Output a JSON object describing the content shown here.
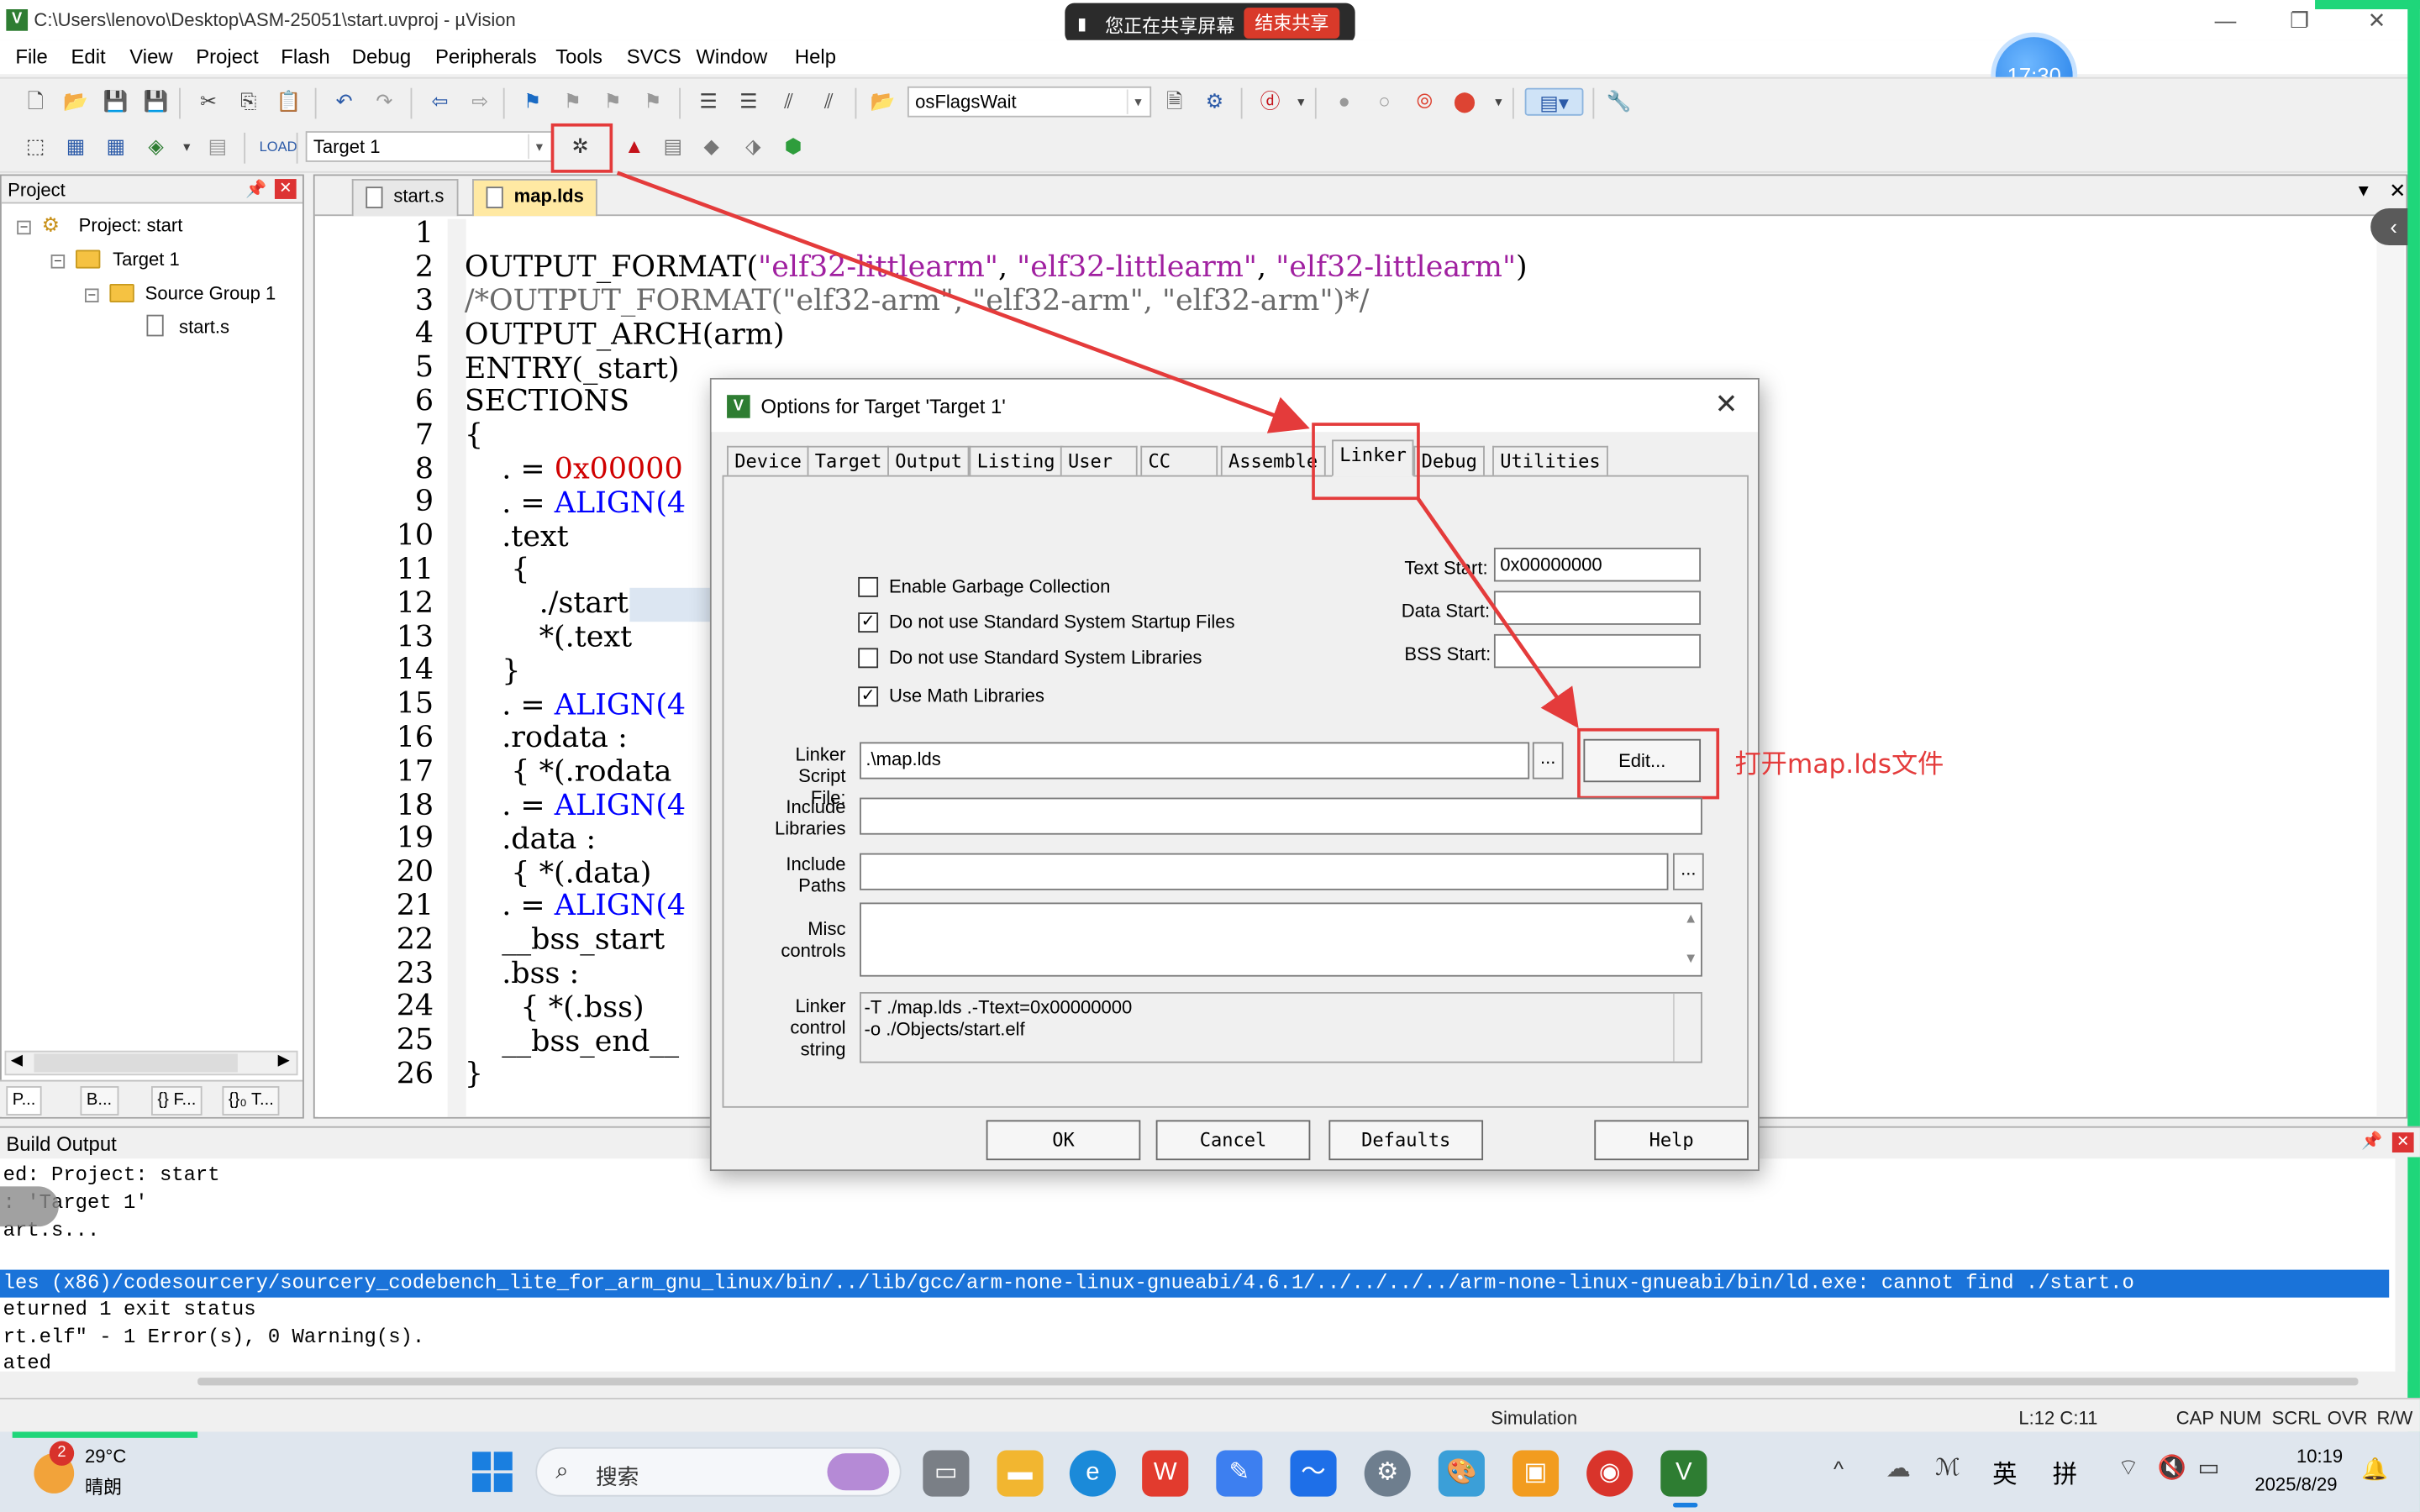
{
  "window": {
    "title": "C:\\Users\\lenovo\\Desktop\\ASM-25051\\start.uvproj - µVision",
    "minimize": "—",
    "maximize": "❐",
    "close": "✕"
  },
  "share_bar": {
    "label": "您正在共享屏幕",
    "stop": "结束共享"
  },
  "clock_bubble": "17:30",
  "menu": [
    "File",
    "Edit",
    "View",
    "Project",
    "Flash",
    "Debug",
    "Peripherals",
    "Tools",
    "SVCS",
    "Window",
    "Help"
  ],
  "toolbar": {
    "function_combo": "osFlagsWait",
    "target_combo": "Target 1"
  },
  "project_panel": {
    "title": "Project",
    "tree": {
      "project": "Project: start",
      "target": "Target 1",
      "group": "Source Group 1",
      "file": "start.s"
    },
    "tabs": [
      "P...",
      "B...",
      "{} F...",
      "{}₀ T..."
    ]
  },
  "editor": {
    "tabs": [
      "start.s",
      "map.lds"
    ],
    "active_tab": "map.lds",
    "lines": [
      "1",
      "2",
      "3",
      "4",
      "5",
      "6",
      "7",
      "8",
      "9",
      "10",
      "11",
      "12",
      "13",
      "14",
      "15",
      "16",
      "17",
      "18",
      "19",
      "20",
      "21",
      "22",
      "23",
      "24",
      "25",
      "26"
    ],
    "code": {
      "l2_a": "OUTPUT_FORMAT(",
      "l2_s1": "\"elf32-littlearm\"",
      "l2_c1": ", ",
      "l2_s2": "\"elf32-littlearm\"",
      "l2_c2": ", ",
      "l2_s3": "\"elf32-littlearm\"",
      "l2_e": ")",
      "l3": "/*OUTPUT_FORMAT(\"elf32-arm\", \"elf32-arm\", \"elf32-arm\")*/",
      "l4": "OUTPUT_ARCH(arm)",
      "l5": "ENTRY(_start)",
      "l6": "SECTIONS",
      "l7": "{",
      "l8_a": "    . = ",
      "l8_n": "0x00000",
      "l9_a": "    . = ",
      "l9_k": "ALIGN(4",
      "l10": "    .text",
      "l11": "     {",
      "l12": "        ./start",
      "l13": "        *(.text",
      "l14": "    }",
      "l15_a": "    . = ",
      "l15_k": "ALIGN(4",
      "l16": "    .rodata :",
      "l17": "     { *(.rodata",
      "l18_a": "    . = ",
      "l18_k": "ALIGN(4",
      "l19": "    .data :",
      "l20": "     { *(.data)",
      "l21_a": "    . = ",
      "l21_k": "ALIGN(4",
      "l22": "    __bss_start",
      "l23": "    .bss :",
      "l24": "      { *(.bss)",
      "l25": "    __bss_end__",
      "l26": "}"
    }
  },
  "dialog": {
    "title": "Options for Target 'Target 1'",
    "close": "✕",
    "tabs": [
      "Device",
      "Target",
      "Output",
      "Listing",
      "User",
      "CC",
      "Assemble",
      "Linker",
      "Debug",
      "Utilities"
    ],
    "active_tab": "Linker",
    "checkboxes": [
      {
        "label": "Enable Garbage Collection",
        "checked": false
      },
      {
        "label": "Do not use Standard System Startup Files",
        "checked": true
      },
      {
        "label": "Do not use Standard System Libraries",
        "checked": false
      },
      {
        "label": "Use Math Libraries",
        "checked": true
      }
    ],
    "text_start_label": "Text Start:",
    "text_start_value": "0x00000000",
    "data_start_label": "Data Start:",
    "data_start_value": "",
    "bss_start_label": "BSS Start:",
    "bss_start_value": "",
    "linker_script_label_1": "Linker Script",
    "linker_script_label_2": "File:",
    "linker_script_value": ".\\map.lds",
    "browse_label": "...",
    "edit_button": "Edit...",
    "include_libraries_label_1": "Include",
    "include_libraries_label_2": "Libraries",
    "include_paths_label_1": "Include",
    "include_paths_label_2": "Paths",
    "misc_controls_label_1": "Misc",
    "misc_controls_label_2": "controls",
    "linker_control_label_1": "Linker",
    "linker_control_label_2": "control",
    "linker_control_label_3": "string",
    "linker_control_line1": "-T ./map.lds .-Ttext=0x00000000",
    "linker_control_line2": "-o ./Objects/start.elf",
    "buttons": {
      "ok": "OK",
      "cancel": "Cancel",
      "defaults": "Defaults",
      "help": "Help"
    }
  },
  "annotation": "打开map.lds文件",
  "build_output": {
    "title": "Build Output",
    "lines": [
      "ed: Project: start",
      ": 'Target 1'",
      "art.s...",
      "les (x86)/codesourcery/sourcery_codebench_lite_for_arm_gnu_linux/bin/../lib/gcc/arm-none-linux-gnueabi/4.6.1/../../../../arm-none-linux-gnueabi/bin/ld.exe: cannot find ./start.o",
      "eturned 1 exit status",
      "rt.elf\" - 1 Error(s), 0 Warning(s).",
      "ated"
    ]
  },
  "status_bar": {
    "mode": "Simulation",
    "position": "L:12 C:11",
    "caps": "CAP",
    "num": "NUM",
    "scrl": "SCRL",
    "ovr": "OVR",
    "rw": "R/W"
  },
  "taskbar": {
    "weather_temp": "29°C",
    "weather_desc": "晴朗",
    "weather_badge": "2",
    "search": "搜索",
    "ime_lang": "英",
    "ime_mode": "拼",
    "time": "10:19",
    "date": "2025/8/29"
  },
  "colors": {
    "accent_red": "#e43b3b",
    "selection_blue": "#1a73d9",
    "string_purple": "#a020a0",
    "keyword_blue": "#0000ff"
  }
}
